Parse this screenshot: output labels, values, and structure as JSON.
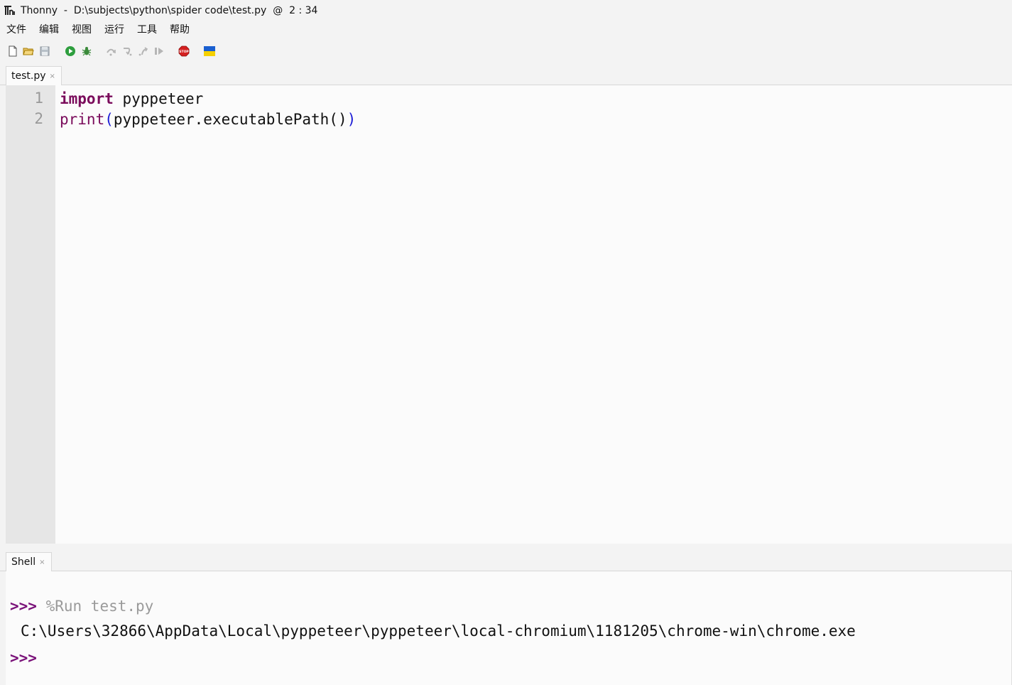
{
  "window": {
    "title": "Thonny  -  D:\\subjects\\python\\spider code\\test.py  @  2 : 34"
  },
  "menu": [
    "文件",
    "编辑",
    "视图",
    "运行",
    "工具",
    "帮助"
  ],
  "toolbar": {
    "icons": [
      "new-file-icon",
      "open-file-icon",
      "save-file-icon",
      "run-icon",
      "debug-icon",
      "step-over-icon",
      "step-into-icon",
      "step-out-icon",
      "resume-icon",
      "stop-icon",
      "ukraine-flag-icon"
    ]
  },
  "editor": {
    "tab_label": "test.py",
    "tab_close": "×",
    "line_numbers": [
      "1",
      "2"
    ],
    "lines": [
      {
        "keyword": "import",
        "rest": " pyppeteer"
      },
      {
        "builtin": "print",
        "open": "(",
        "middle": "pyppeteer.executablePath()",
        "close": ")"
      }
    ]
  },
  "shell": {
    "tab_label": "Shell",
    "tab_close": "×",
    "prompt": ">>>",
    "command": " %Run test.py",
    "output": "C:\\Users\\32866\\AppData\\Local\\pyppeteer\\pyppeteer\\local-chromium\\1181205\\chrome-win\\chrome.exe",
    "prompt2": ">>>"
  },
  "colors": {
    "keyword": "#7a0b5b",
    "paren": "#1c1cd6",
    "prompt": "#7a1279",
    "command": "#9a9a9a",
    "stop": "#d42020"
  }
}
